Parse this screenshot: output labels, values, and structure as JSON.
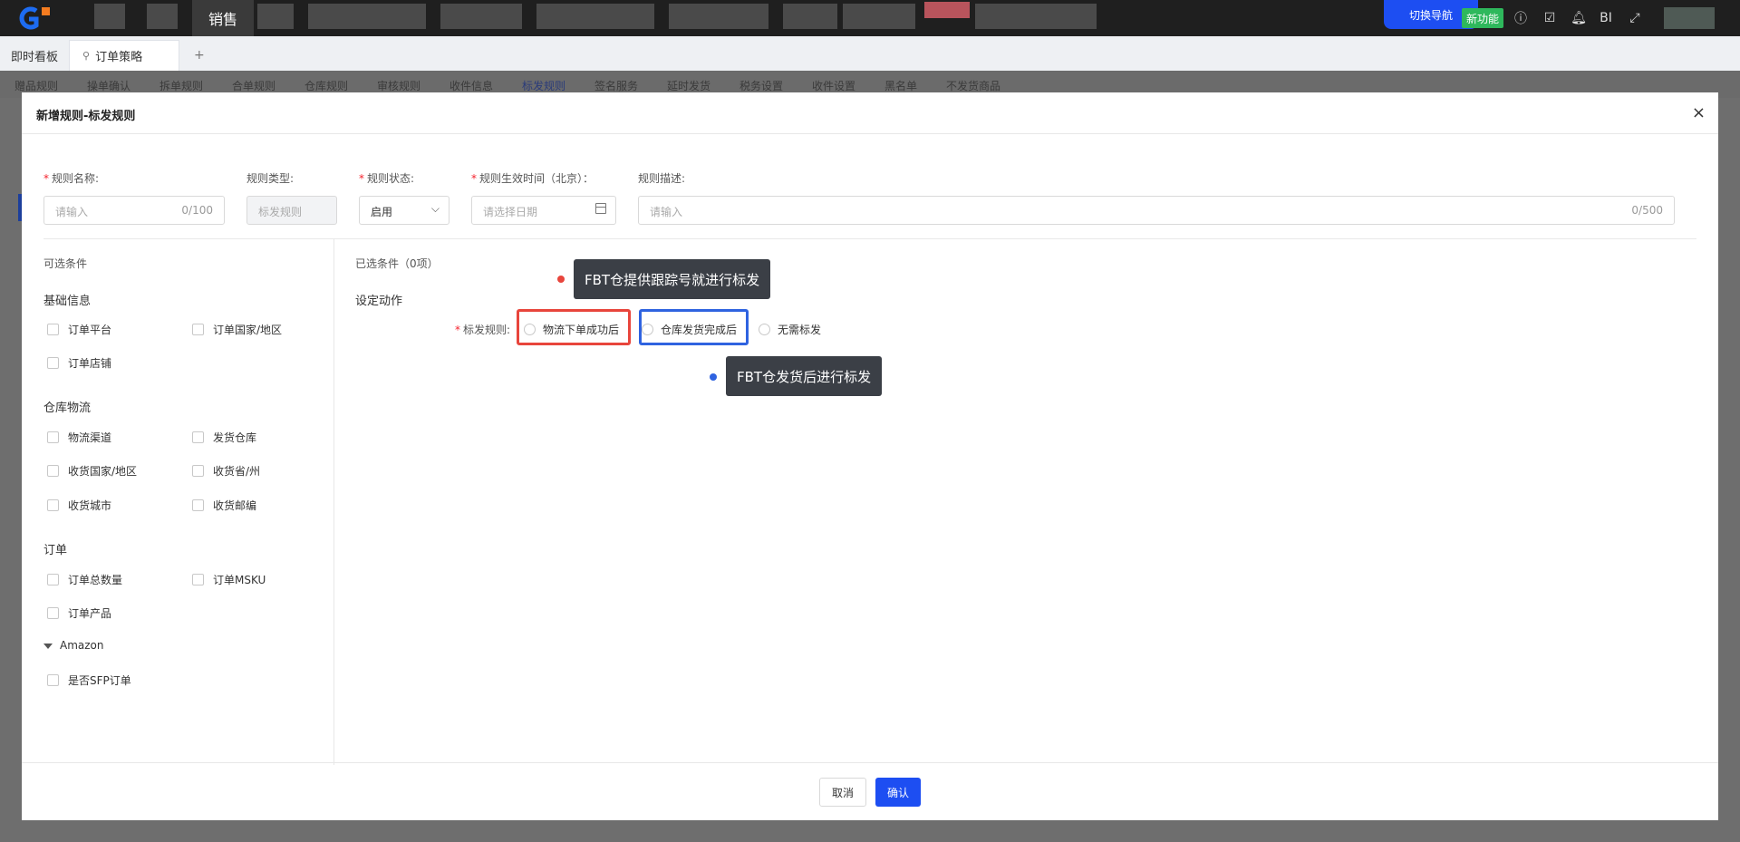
{
  "topbar": {
    "active_module": "销售",
    "switch_nav_label": "切换导航",
    "new_feature_label": "新功能",
    "bi_label": "BI",
    "colors": {
      "bg": "#1f1f1f",
      "switch_nav": "#1d4ef2",
      "new_feature": "#2eb85c"
    },
    "icons": [
      "info-icon",
      "calendar-check-icon",
      "bell-icon",
      "bi-icon",
      "fullscreen-icon",
      "avatar"
    ]
  },
  "tabs": {
    "items": [
      {
        "label": "即时看板"
      },
      {
        "label": "订单策略"
      }
    ],
    "add_label": "+"
  },
  "subnav": {
    "items": [
      "赠品规则",
      "操单确认",
      "拆单规则",
      "合单规则",
      "仓库规则",
      "审核规则",
      "收件信息",
      "标发规则",
      "签名服务",
      "延时发货",
      "税务设置",
      "收件设置",
      "黑名单",
      "不发货商品"
    ],
    "active": "标发规则"
  },
  "modal": {
    "title": "新增规则-标发规则",
    "close_icon": "×",
    "form": {
      "name": {
        "label": "规则名称:",
        "placeholder": "请输入",
        "counter": "0/100"
      },
      "type": {
        "label": "规则类型:",
        "value": "标发规则"
      },
      "status": {
        "label": "规则状态:",
        "value": "启用"
      },
      "effective_time": {
        "label": "规则生效时间（北京）：",
        "placeholder": "请选择日期"
      },
      "description": {
        "label": "规则描述:",
        "placeholder": "请输入",
        "counter": "0/500"
      }
    },
    "left_panel": {
      "title": "可选条件",
      "sections": [
        {
          "title": "基础信息",
          "items": [
            "订单平台",
            "订单国家/地区",
            "订单店铺"
          ]
        },
        {
          "title": "仓库物流",
          "items": [
            "物流渠道",
            "发货仓库",
            "收货国家/地区",
            "收货省/州",
            "收货城市",
            "收货邮编"
          ]
        },
        {
          "title": "订单",
          "items": [
            "订单总数量",
            "订单MSKU",
            "订单产品"
          ]
        },
        {
          "title": "Amazon",
          "items": [
            "是否SFP订单"
          ]
        }
      ]
    },
    "right_panel": {
      "selected_title": "已选条件（0项）",
      "action_title": "设定动作",
      "rule_label": "标发规则:",
      "options": [
        "物流下单成功后",
        "仓库发货完成后",
        "无需标发"
      ]
    },
    "annotations": {
      "red": "FBT仓提供跟踪号就进行标发",
      "blue": "FBT仓发货后进行标发",
      "colors": {
        "red": "#e8453c",
        "blue": "#2f63e0"
      }
    },
    "footer": {
      "cancel_label": "取消",
      "confirm_label": "确认"
    }
  }
}
